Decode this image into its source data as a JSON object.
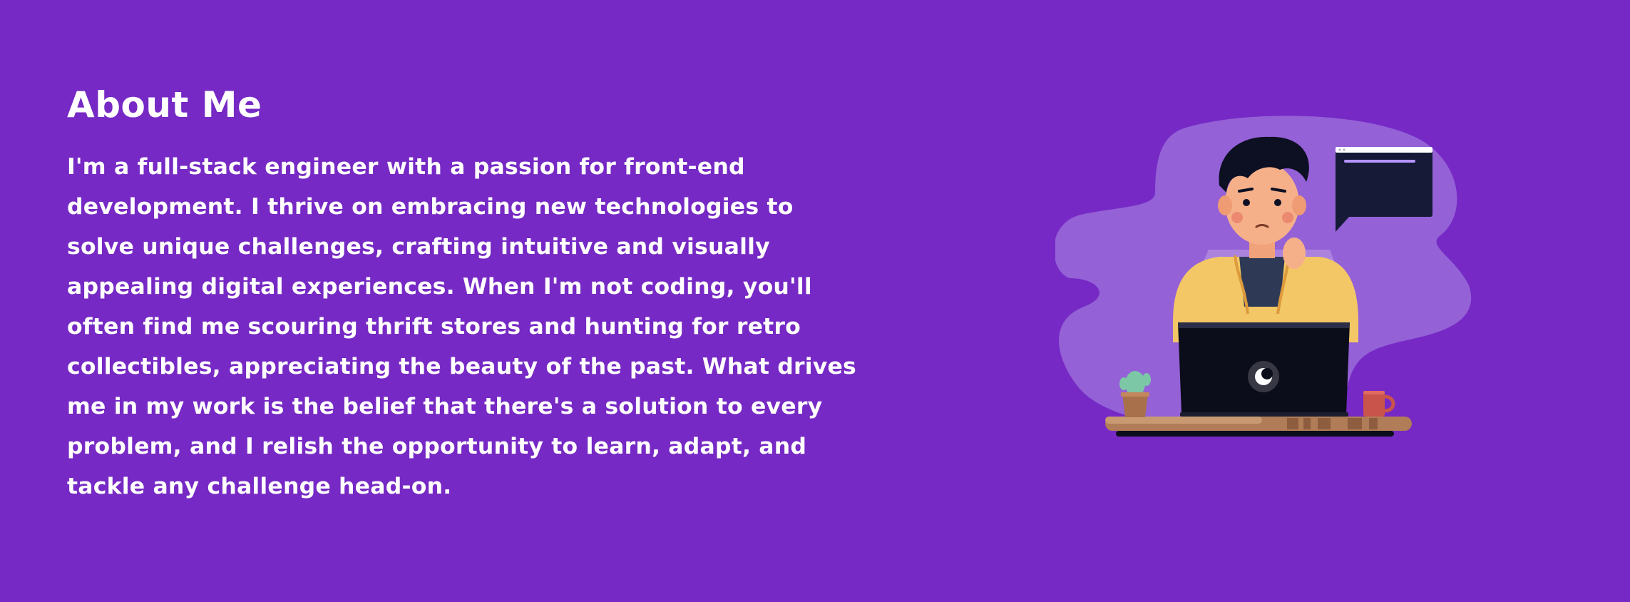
{
  "about": {
    "title": "About Me",
    "body": "I'm a full-stack engineer with a passion for front-end development. I thrive on embracing new technologies to solve unique challenges, crafting intuitive and visually appealing digital experiences. When I'm not coding, you'll often find me scouring thrift stores and hunting for retro collectibles, appreciating the beauty of the past. What drives me in my work is the belief that there's a solution to every problem, and I relish the opportunity to learn, adapt, and tackle any challenge head-on."
  },
  "colors": {
    "background": "#7629c4",
    "blob": "#9461d7",
    "text": "#ffffff"
  },
  "illustration": {
    "subject": "developer-at-laptop-illustration"
  }
}
